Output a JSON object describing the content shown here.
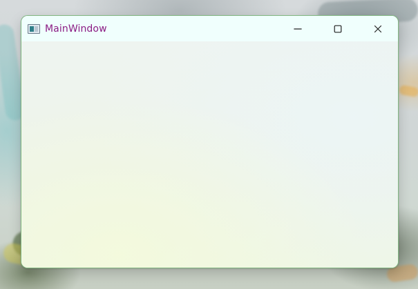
{
  "window": {
    "title": "MainWindow",
    "title_color": "#8b1c84",
    "icons": {
      "app": "app-window-icon",
      "minimize": "minimize-icon",
      "maximize": "maximize-icon",
      "close": "close-icon"
    }
  }
}
